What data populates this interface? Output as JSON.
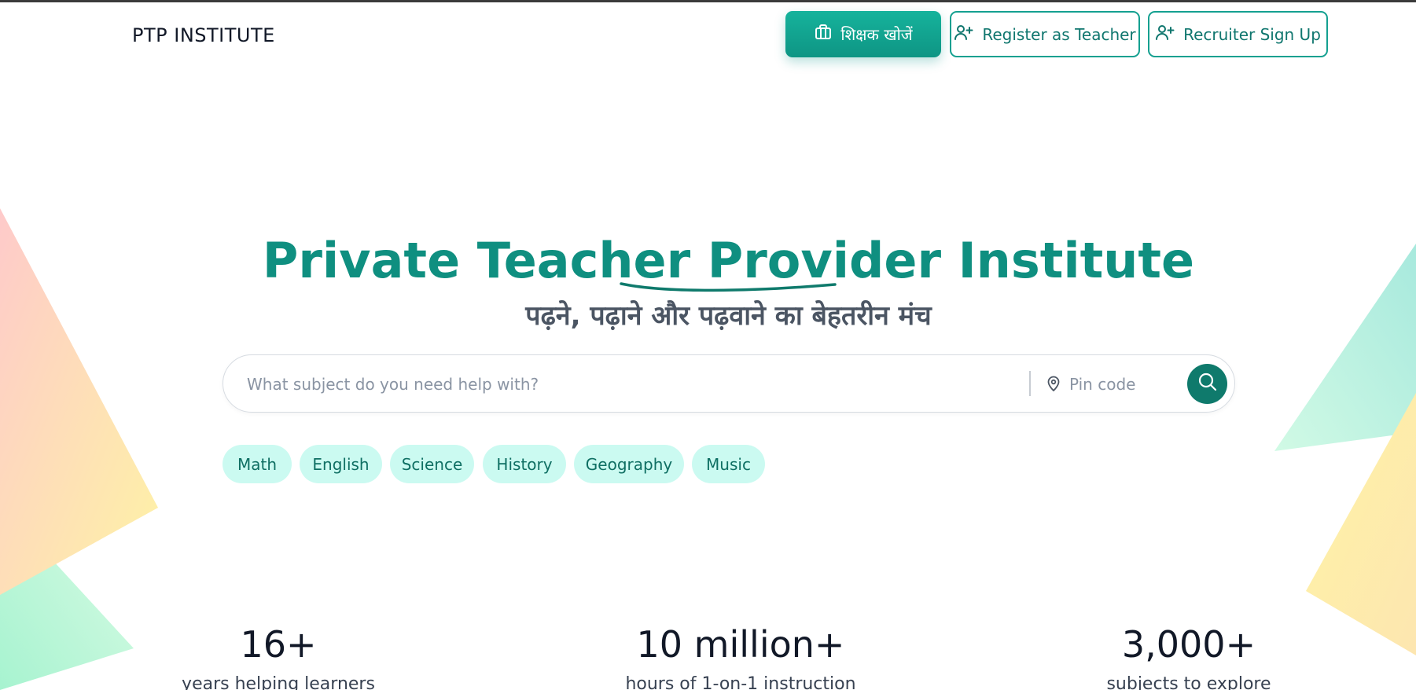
{
  "header": {
    "brand": "PTP INSTITUTE",
    "find_teacher_label": "शिक्षक खोजें",
    "register_teacher_label": "Register as Teacher",
    "recruiter_signup_label": "Recruiter Sign Up"
  },
  "hero": {
    "title": "Private Teacher Provider Institute",
    "subtitle": "पढ़ने, पढ़ाने और पढ़वाने का बेहतरीन मंच"
  },
  "search": {
    "subject_placeholder": "What subject do you need help with?",
    "subject_value": "",
    "pincode_placeholder": "Pin code",
    "pincode_value": ""
  },
  "chips": [
    "Math",
    "English",
    "Science",
    "History",
    "Geography",
    "Music"
  ],
  "stats": [
    {
      "value": "16+",
      "label": "years helping learners"
    },
    {
      "value": "10 million+",
      "label": "hours of 1-on-1 instruction"
    },
    {
      "value": "3,000+",
      "label": "subjects to explore"
    }
  ],
  "icons": {
    "find_teacher": "briefcase-icon",
    "register_teacher": "user-plus-icon",
    "recruiter_signup": "user-plus-icon",
    "pincode": "map-pin-icon",
    "search": "search-icon"
  },
  "colors": {
    "brand_teal": "#0f8f80",
    "button_teal": "#14a090",
    "search_button": "#0f7a6c",
    "chip_background": "#cbfaf1",
    "chip_text": "#0f6f63"
  }
}
